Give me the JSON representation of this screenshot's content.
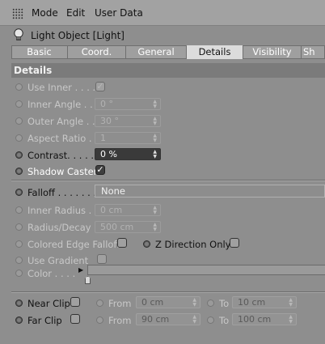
{
  "menu": {
    "items": [
      "Mode",
      "Edit",
      "User Data"
    ]
  },
  "object": {
    "title": "Light Object [Light]"
  },
  "tabs": [
    "Basic",
    "Coord.",
    "General",
    "Details",
    "Visibility",
    "Sh"
  ],
  "active_tab": "Details",
  "section": {
    "title": "Details"
  },
  "rows": {
    "use_inner": {
      "label": "Use Inner . . . . .",
      "checked": true
    },
    "inner_angle": {
      "label": "Inner Angle . . .",
      "value": "0 °"
    },
    "outer_angle": {
      "label": "Outer Angle . . .",
      "value": "30 °"
    },
    "aspect_ratio": {
      "label": "Aspect Ratio . .",
      "value": "1"
    },
    "contrast": {
      "label": "Contrast. . . . . . .",
      "value": "0 %"
    },
    "shadow_caster": {
      "label": "Shadow Caster",
      "checked": true
    },
    "falloff": {
      "label": "Falloff . . . . . . . .",
      "value": "None"
    },
    "inner_radius": {
      "label": "Inner Radius . .",
      "value": "0 cm"
    },
    "radius_decay": {
      "label": "Radius/Decay",
      "value": "500 cm"
    },
    "colored_edge_falloff": {
      "label": "Colored Edge Falloff"
    },
    "z_direction_only": {
      "label": "Z Direction Only"
    },
    "use_gradient": {
      "label": "Use Gradient"
    },
    "color": {
      "label": "Color . . . ."
    },
    "near_clip": {
      "label": "Near Clip",
      "from_label": "From",
      "from_value": "0 cm",
      "to_label": "To",
      "to_value": "10 cm"
    },
    "far_clip": {
      "label": "Far Clip",
      "from_label": "From",
      "from_value": "90 cm",
      "to_label": "To",
      "to_value": "100 cm"
    }
  },
  "icons": {
    "grip": "grip-icon",
    "bulb": "light-bulb-icon",
    "check": "✓",
    "spinner": "▲▼"
  },
  "colors": {
    "background": "#8e8e8e",
    "active_tab": "#dcdcdc",
    "section_header": "#7b7b7b",
    "dark_field": "#3a3a3a"
  }
}
